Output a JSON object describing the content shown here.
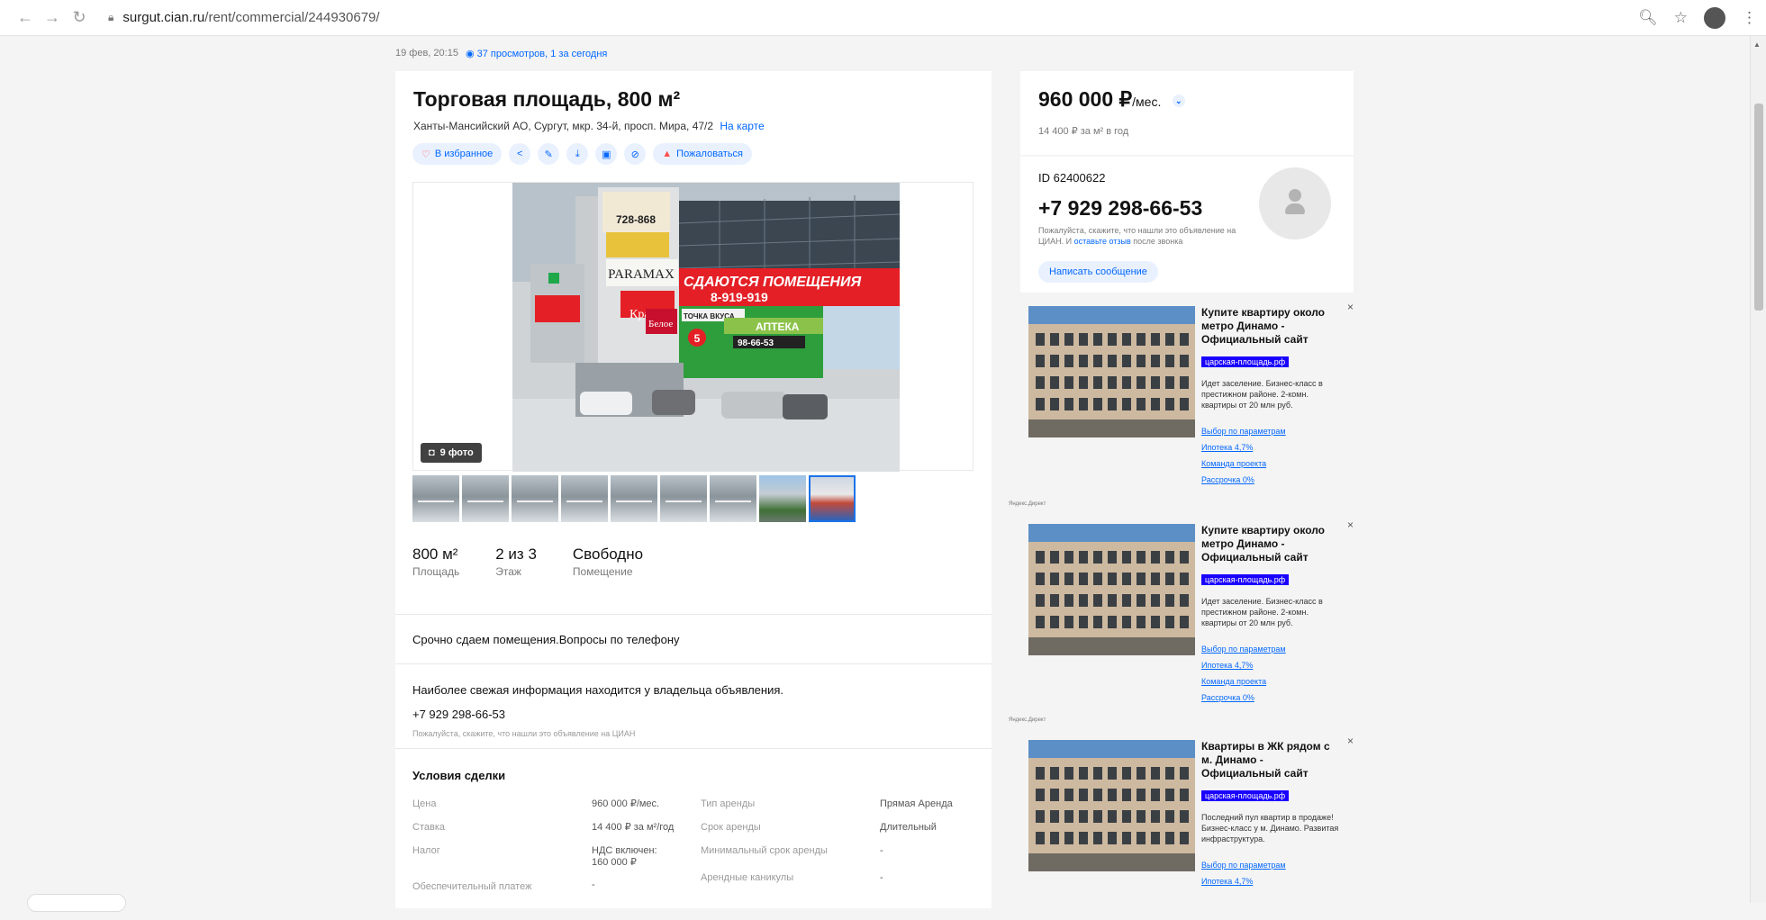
{
  "browser": {
    "url_host": "surgut.cian.ru",
    "url_path": "/rent/commercial/244930679/"
  },
  "meta": {
    "date": "19 фев, 20:15",
    "views": "37 просмотров, 1 за сегодня"
  },
  "listing": {
    "title": "Торговая площадь, 800 м²",
    "address": "Ханты-Мансийский АО, Сургут, мкр. 34-й, просп. Мира, 47/2",
    "map_link": "На карте",
    "actions": {
      "favorite": "В избранное",
      "complain": "Пожаловаться"
    },
    "photo_count": "9 фото",
    "facts": [
      {
        "value": "800 м²",
        "label": "Площадь"
      },
      {
        "value": "2 из 3",
        "label": "Этаж"
      },
      {
        "value": "Свободно",
        "label": "Помещение"
      }
    ],
    "description": "Срочно сдаем помещения.Вопросы по телефону",
    "fresh_info": "Наиболее свежая информация находится у владельца объявления.",
    "phone": "+7 929 298-66-53",
    "phone_note": "Пожалуйста, скажите, что нашли это объявление на ЦИАН",
    "conditions_title": "Условия сделки",
    "conditions": [
      {
        "k1": "Цена",
        "v1": "960 000 ₽/мес.",
        "k2": "Тип аренды",
        "v2": "Прямая Аренда"
      },
      {
        "k1": "Ставка",
        "v1": "14 400 ₽ за м²/год",
        "k2": "Срок аренды",
        "v2": "Длительный"
      },
      {
        "k1": "Налог",
        "v1": "НДС включен: 160 000 ₽",
        "k2": "Минимальный срок аренды",
        "v2": "-"
      },
      {
        "k1": "Обеспечительный платеж",
        "v1": "-",
        "k2": "Арендные каникулы",
        "v2": "-"
      }
    ]
  },
  "price_card": {
    "price": "960 000 ₽",
    "unit": "/мес.",
    "per_meter": "14 400 ₽ за м² в год"
  },
  "contact": {
    "id": "ID 62400622",
    "phone": "+7 929 298-66-53",
    "note_prefix": "Пожалуйста, скажите, что нашли это объявление на ЦИАН. И",
    "note_link": "оставьте отзыв",
    "note_suffix": "после звонка",
    "message_button": "Написать сообщение"
  },
  "ads": [
    {
      "title": "Купите квартиру около метро Динамо - Официальный сайт",
      "domain": "царская-площадь.рф",
      "text": "Идет заселение. Бизнес-класс в престижном районе. 2-комн. квартиры от 20 млн руб.",
      "links": [
        "Выбор по параметрам",
        "Ипотека 4,7%",
        "Команда проекта",
        "Рассрочка 0%"
      ]
    },
    {
      "title": "Купите квартиру около метро Динамо - Официальный сайт",
      "domain": "царская-площадь.рф",
      "text": "Идет заселение. Бизнес-класс в престижном районе. 2-комн. квартиры от 20 млн руб.",
      "links": [
        "Выбор по параметрам",
        "Ипотека 4,7%",
        "Команда проекта",
        "Рассрочка 0%"
      ]
    },
    {
      "title": "Квартиры в ЖК рядом с м. Динамо - Официальный сайт",
      "domain": "царская-площадь.рф",
      "text": "Последний пул квартир в продаже! Бизнес-класс у м. Динамо. Развитая инфраструктура.",
      "links": [
        "Выбор по параметрам",
        "Ипотека 4,7%"
      ]
    }
  ],
  "ad_label": "Яндекс.Директ",
  "photo_signs": {
    "phone_top": "728-868",
    "paramax": "PARAMAX",
    "rent": "СДАЮТСЯ ПОМЕЩЕНИЯ",
    "rent_phone": "8-919-919",
    "krasnoe": "Красное",
    "beloe": "Белое",
    "tochka": "ТОЧКА ВКУСА",
    "apteka": "АПТЕКА",
    "apteka_phone": "98-66-53",
    "five": "5"
  }
}
